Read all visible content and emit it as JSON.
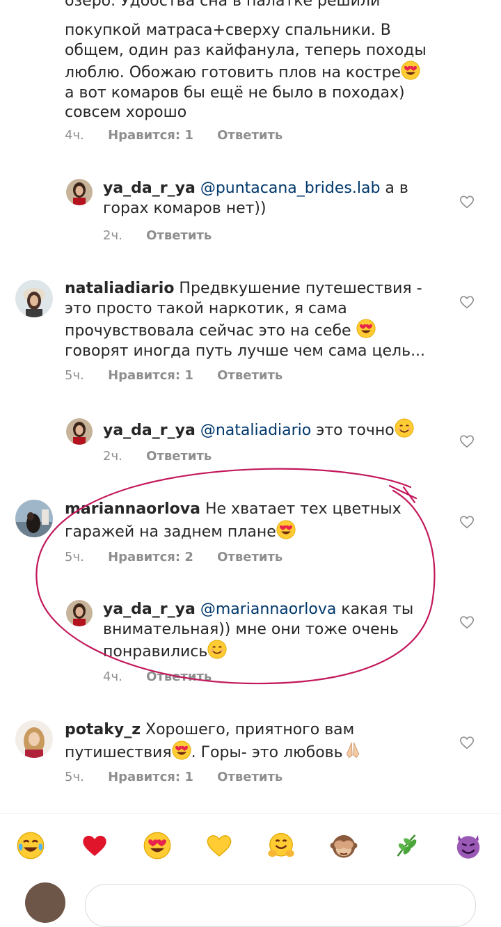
{
  "comments": [
    {
      "id": "c1",
      "text_lines": [
        "озеро. Удобства сна в палатке решили",
        "покупкой матраса+сверху спальники. В",
        "общем, один раз кайфанула, теперь походы",
        "люблю. Обожаю готовить плов на костре",
        "а вот комаров бы ещё не было в походах)",
        "совсем хорошо"
      ],
      "time": "4ч.",
      "likes": "Нравится: 1",
      "reply": "Ответить"
    },
    {
      "id": "r1",
      "user": "ya_da_r_ya",
      "mention": "@puntacana_brides.lab",
      "text_a": " а в",
      "text_b": "горах комаров нет))",
      "time": "2ч.",
      "reply": "Ответить"
    },
    {
      "id": "c2",
      "user": "nataliadiario",
      "line1": " Предвкушение путешествия -",
      "line2": "это просто такой наркотик, я сама",
      "line3": "прочувствовала сейчас это на себе",
      "line4": "говорят иногда путь лучше чем сама цель...",
      "time": "5ч.",
      "likes": "Нравится: 1",
      "reply": "Ответить"
    },
    {
      "id": "r2",
      "user": "ya_da_r_ya",
      "mention": "@nataliadiario",
      "text": " это точно",
      "time": "2ч.",
      "reply": "Ответить"
    },
    {
      "id": "c3",
      "user": "mariannaorlova",
      "line1": " Не хватает тех цветных",
      "line2": "гаражей на заднем плане",
      "time": "5ч.",
      "likes": "Нравится: 2",
      "reply": "Ответить"
    },
    {
      "id": "r3",
      "user": "ya_da_r_ya",
      "mention": "@mariannaorlova",
      "text_a": " какая ты",
      "text_b": "внимательная)) мне они тоже очень",
      "text_c": "понравились",
      "time": "4ч.",
      "reply": "Ответить"
    },
    {
      "id": "c4",
      "user": "potaky_z",
      "line1": " Хорошего, приятного вам",
      "line2a": "путишествия",
      "line2b": ". Горы- это любовь",
      "time": "5ч.",
      "likes": "Нравится: 1",
      "reply": "Ответить"
    }
  ],
  "emoji_bar": [
    "face-with-tears-of-joy",
    "red-heart",
    "heart-eyes",
    "yellow-heart",
    "hugging-face",
    "see-no-evil-monkey",
    "herb",
    "smiling-devil"
  ],
  "colors": {
    "text": "#262626",
    "meta": "#8e8e8e",
    "mention": "#00376b",
    "annotation": "#c2185b"
  }
}
